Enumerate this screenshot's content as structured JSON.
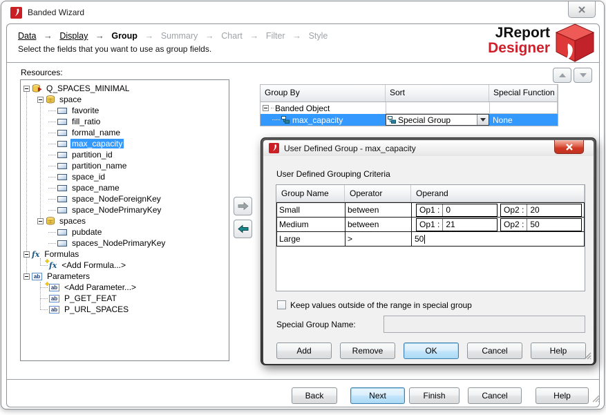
{
  "window": {
    "title": "Banded Wizard"
  },
  "breadcrumb": {
    "arrow": "→",
    "steps": [
      "Data",
      "Display",
      "Group",
      "Summary",
      "Chart",
      "Filter",
      "Style"
    ],
    "subtitle": "Select the fields that you want to use as group fields."
  },
  "logo": {
    "line1": "JReport",
    "line2": "Designer"
  },
  "icons": {
    "formula_glyph": "fx",
    "parameter_glyph": "ab",
    "plus_glyph": "+"
  },
  "resources": {
    "label": "Resources:",
    "tree": [
      {
        "label": "Q_SPACES_MINIMAL",
        "icon": "query",
        "level": 0
      },
      {
        "label": "space",
        "icon": "table",
        "level": 1
      },
      {
        "label": "favorite",
        "icon": "field",
        "level": 2
      },
      {
        "label": "fill_ratio",
        "icon": "field",
        "level": 2
      },
      {
        "label": "formal_name",
        "icon": "field",
        "level": 2
      },
      {
        "label": "max_capacity",
        "icon": "field",
        "level": 2,
        "selected": true
      },
      {
        "label": "partition_id",
        "icon": "field",
        "level": 2
      },
      {
        "label": "partition_name",
        "icon": "field",
        "level": 2
      },
      {
        "label": "space_id",
        "icon": "field",
        "level": 2
      },
      {
        "label": "space_name",
        "icon": "field",
        "level": 2
      },
      {
        "label": "space_NodeForeignKey",
        "icon": "field",
        "level": 2
      },
      {
        "label": "space_NodePrimaryKey",
        "icon": "field",
        "level": 2
      },
      {
        "label": "spaces",
        "icon": "table",
        "level": 1
      },
      {
        "label": "pubdate",
        "icon": "field",
        "level": 2
      },
      {
        "label": "spaces_NodePrimaryKey",
        "icon": "field",
        "level": 2
      },
      {
        "label": "Formulas",
        "icon": "formula",
        "level": 0
      },
      {
        "label": "<Add Formula...>",
        "icon": "add-formula",
        "level": 1
      },
      {
        "label": "Parameters",
        "icon": "parameter",
        "level": 0
      },
      {
        "label": "<Add Parameter...>",
        "icon": "add-parameter",
        "level": 1
      },
      {
        "label": "P_GET_FEAT",
        "icon": "parameter",
        "level": 1
      },
      {
        "label": "P_URL_SPACES",
        "icon": "parameter",
        "level": 1
      }
    ]
  },
  "group_table": {
    "columns": [
      "Group By",
      "Sort",
      "Special Function"
    ],
    "root": "Banded Object",
    "row": {
      "field": "max_capacity",
      "sort": "Special Group",
      "special_function": "None"
    }
  },
  "dialog": {
    "title": "User Defined Group - max_capacity",
    "criteria_label": "User Defined Grouping Criteria",
    "columns": [
      "Group Name",
      "Operator",
      "Operand"
    ],
    "rows": [
      {
        "group_name": "Small",
        "operator": "between",
        "op1_label": "Op1 :",
        "op1": "0",
        "op2_label": "Op2 :",
        "op2": "20"
      },
      {
        "group_name": "Medium",
        "operator": "between",
        "op1_label": "Op1 :",
        "op1": "21",
        "op2_label": "Op2 :",
        "op2": "50"
      },
      {
        "group_name": "Large",
        "operator": ">",
        "operand": "50"
      }
    ],
    "checkbox_label": "Keep values outside of the range in special group",
    "checkbox_checked": false,
    "special_group_name_label": "Special Group Name:",
    "special_group_name_value": "",
    "buttons": {
      "add": "Add",
      "remove": "Remove",
      "ok": "OK",
      "cancel": "Cancel",
      "help": "Help"
    }
  },
  "wizard_buttons": {
    "back": "Back",
    "next": "Next",
    "finish": "Finish",
    "cancel": "Cancel",
    "help": "Help"
  },
  "colors": {
    "selection": "#3399ff",
    "brand_red": "#cf1f2e",
    "default_button_border": "#3c7fb1"
  }
}
